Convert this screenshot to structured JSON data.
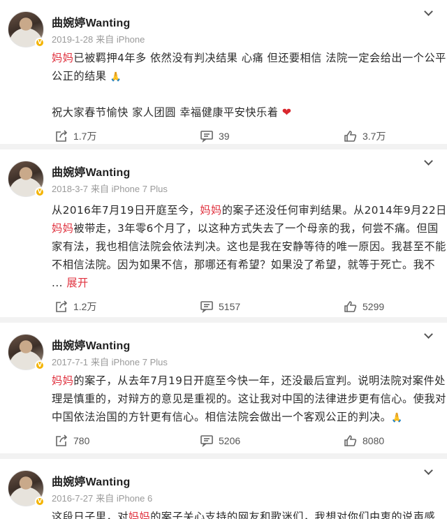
{
  "posts": [
    {
      "author": "曲婉婷Wanting",
      "date": "2019-1-28",
      "source": "来自 iPhone",
      "body": [
        [
          {
            "t": "妈妈",
            "hl": true
          },
          {
            "t": "已被羁押4年多 依然没有判决结果 心痛 但还要相信 法院一定会给出一个公平"
          }
        ],
        [
          {
            "t": "公正的结果 "
          },
          {
            "t": "🙏",
            "emoji": "pray"
          }
        ],
        [],
        [
          {
            "t": "祝大家春节愉快 家人团圆 幸福健康平安快乐着 "
          },
          {
            "t": "❤",
            "emoji": "heart"
          }
        ]
      ],
      "shares": "1.7万",
      "comments": "39",
      "likes": "3.7万"
    },
    {
      "author": "曲婉婷Wanting",
      "date": "2018-3-7",
      "source": "来自 iPhone 7 Plus",
      "body": [
        [
          {
            "t": "从2016年7月19日开庭至今，"
          },
          {
            "t": "妈妈",
            "hl": true
          },
          {
            "t": "的案子还没任何审判结果。从2014年9月22日"
          }
        ],
        [
          {
            "t": "妈妈",
            "hl": true
          },
          {
            "t": "被带走，3年零6个月了，以这种方式失去了一个母亲的我，何尝不痛。但国"
          }
        ],
        [
          {
            "t": "家有法，我也相信法院会依法判决。这也是我在安静等待的唯一原因。我甚至不能"
          }
        ],
        [
          {
            "t": "不相信法院。因为如果不信，那哪还有希望？如果没了希望，就等于死亡。我不"
          }
        ],
        [
          {
            "t": "... "
          },
          {
            "t": "展开",
            "link": true
          }
        ]
      ],
      "shares": "1.2万",
      "comments": "5157",
      "likes": "5299"
    },
    {
      "author": "曲婉婷Wanting",
      "date": "2017-7-1",
      "source": "来自 iPhone 7 Plus",
      "body": [
        [
          {
            "t": "妈妈",
            "hl": true
          },
          {
            "t": "的案子，从去年7月19日开庭至今快一年，还没最后宣判。说明法院对案件处"
          }
        ],
        [
          {
            "t": "理是慎重的，对辩方的意见是重视的。这让我对中国的法律进步更有信心。使我对"
          }
        ],
        [
          {
            "t": "中国依法治国的方针更有信心。相信法院会做出一个客观公正的判决。"
          },
          {
            "t": "🙏",
            "emoji": "pray"
          }
        ]
      ],
      "shares": "780",
      "comments": "5206",
      "likes": "8080"
    },
    {
      "author": "曲婉婷Wanting",
      "date": "2016-7-27",
      "source": "来自 iPhone 6",
      "body": [
        [
          {
            "t": "这段日子里，对"
          },
          {
            "t": "妈妈",
            "hl": true
          },
          {
            "t": "的案子关心支持的网友和歌迷们，我想对你们由衷的说声感"
          }
        ]
      ],
      "shares": "",
      "comments": "",
      "likes": ""
    }
  ]
}
